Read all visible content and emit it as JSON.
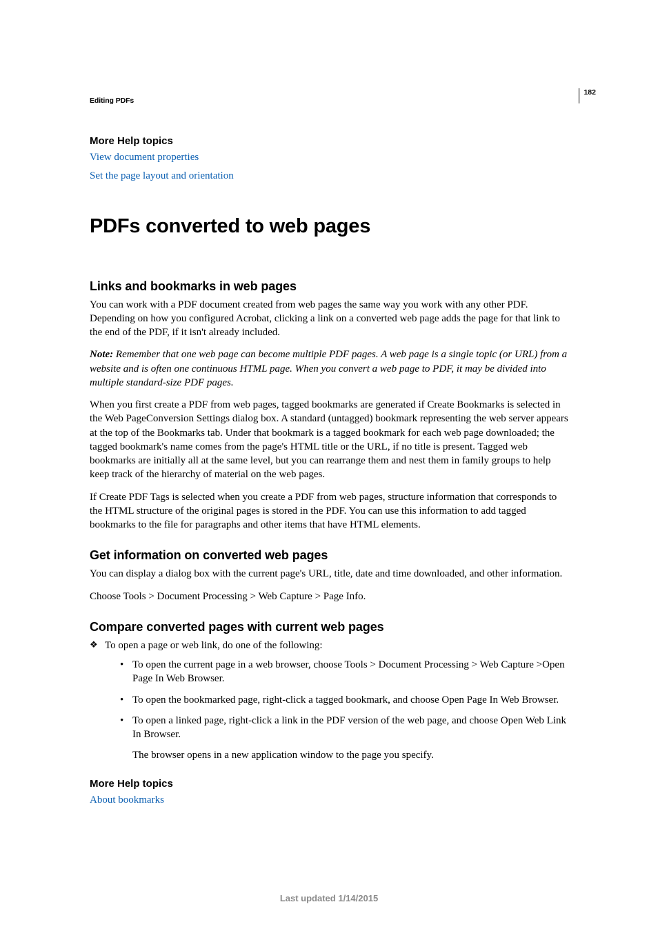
{
  "page_number": "182",
  "breadcrumb": "Editing PDFs",
  "help1": {
    "heading": "More Help topics",
    "links": [
      "View document properties",
      "Set the page layout and orientation"
    ]
  },
  "title": "PDFs converted to web pages",
  "section1": {
    "heading": "Links and bookmarks in web pages",
    "p1": "You can work with a PDF document created from web pages the same way you work with any other PDF. Depending on how you configured Acrobat, clicking a link on a converted web page adds the page for that link to the end of the PDF, if it isn't already included.",
    "note_label": "Note: ",
    "note": "Remember that one web page can become multiple PDF pages. A web page is a single topic (or URL) from a website and is often one continuous HTML page. When you convert a web page to PDF, it may be divided into multiple standard-size PDF pages.",
    "p2": "When you first create a PDF from web pages, tagged bookmarks are generated if Create Bookmarks is selected in the Web PageConversion Settings dialog box. A standard (untagged) bookmark representing the web server appears at the top of the Bookmarks tab. Under that bookmark is a tagged bookmark for each web page downloaded; the tagged bookmark's name comes from the page's HTML title or the URL, if no title is present. Tagged web bookmarks are initially all at the same level, but you can rearrange them and nest them in family groups to help keep track of the hierarchy of material on the web pages.",
    "p3": "If Create PDF Tags is selected when you create a PDF from web pages, structure information that corresponds to the HTML structure of the original pages is stored in the PDF. You can use this information to add tagged bookmarks to the file for paragraphs and other items that have HTML elements."
  },
  "section2": {
    "heading": "Get information on converted web pages",
    "p1": "You can display a dialog box with the current page's URL, title, date and time downloaded, and other information.",
    "p2": "Choose Tools > Document Processing > Web Capture > Page Info."
  },
  "section3": {
    "heading": "Compare converted pages with current web pages",
    "lead": "To open a page or web link, do one of the following:",
    "items": [
      "To open the current page in a web browser, choose Tools > Document Processing > Web Capture >Open Page In Web Browser.",
      "To open the bookmarked page, right-click a tagged bookmark, and choose Open Page In Web Browser.",
      "To open a linked page, right-click a link in the PDF version of the web page, and choose Open Web Link In Browser."
    ],
    "follow": "The browser opens in a new application window to the page you specify."
  },
  "help2": {
    "heading": "More Help topics",
    "links": [
      "About bookmarks"
    ]
  },
  "footer": "Last updated 1/14/2015"
}
